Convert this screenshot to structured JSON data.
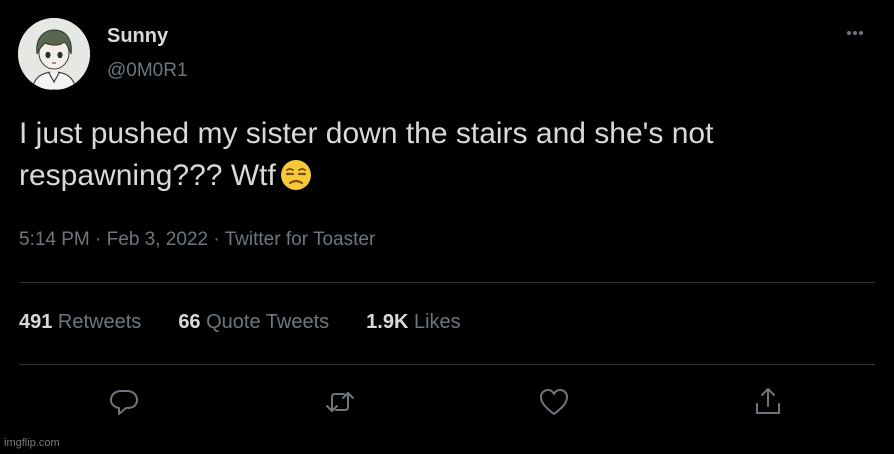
{
  "author": {
    "display_name": "Sunny",
    "handle": "@0M0R1",
    "avatar_icon": "cartoon-boy-avatar"
  },
  "tweet": {
    "text": "I just pushed my sister down the stairs and she's not respawning??? Wtf",
    "emoji": "unamused-face-emoji"
  },
  "meta": {
    "time": "5:14 PM",
    "date": "Feb 3, 2022",
    "source": "Twitter for Toaster",
    "separator": " · "
  },
  "stats": {
    "retweets_count": "491",
    "retweets_label": " Retweets",
    "quotes_count": "66",
    "quotes_label": " Quote Tweets",
    "likes_count": "1.9K",
    "likes_label": " Likes"
  },
  "actions": [
    "reply-icon",
    "retweet-icon",
    "like-icon",
    "share-icon"
  ],
  "watermark": "imgflip.com",
  "colors": {
    "background": "#000000",
    "primary_text": "#d9d9d9",
    "secondary_text": "#6e767d",
    "divider": "#2f3336"
  }
}
